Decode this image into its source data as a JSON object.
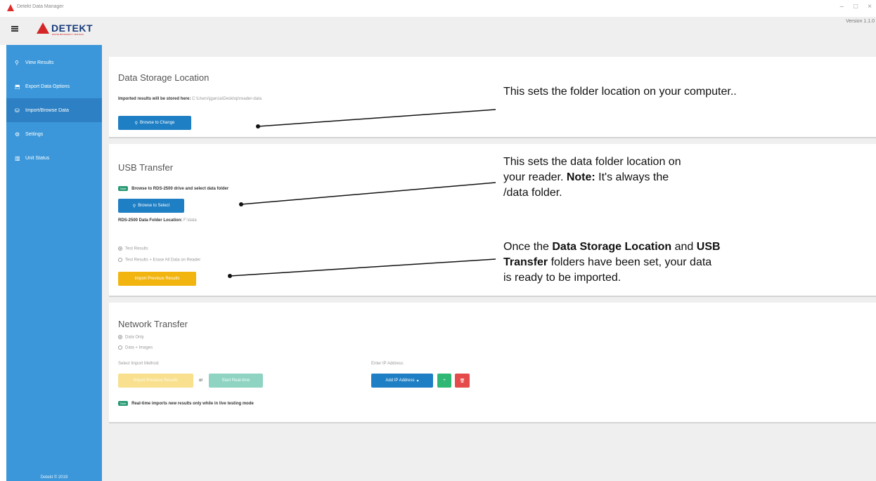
{
  "window": {
    "title": "Detekt Data Manager",
    "version": "Version 1.1.0",
    "controls": [
      "–",
      "□",
      "×"
    ]
  },
  "logo": {
    "name": "DETEKT",
    "tagline": "RAPID BIOSAFETY TESTING"
  },
  "sidebar": {
    "items": [
      {
        "label": "View Results",
        "icon": "search-icon"
      },
      {
        "label": "Export Data Options",
        "icon": "export-icon"
      },
      {
        "label": "Import/Browse Data",
        "icon": "database-icon",
        "active": true
      },
      {
        "label": "Settings",
        "icon": "gear-icon"
      },
      {
        "label": "Unit Status",
        "icon": "status-icon"
      }
    ],
    "footer": "Detekt © 2019"
  },
  "storage": {
    "title": "Data Storage Location",
    "label": "Imported results will be stored here:",
    "path": "C:\\Users\\jgarcia\\Desktop\\reader-data",
    "button": "Browse to Change"
  },
  "usb": {
    "title": "USB Transfer",
    "note_badge": "Note",
    "note_text": "Browse to RDS-2500 drive and select data folder",
    "button": "Browse to Select",
    "folder_label": "RDS-2500 Data Folder Location:",
    "folder_value": "F:\\data",
    "options": [
      "Test Results",
      "Test Results + Erase All Data on Reader"
    ],
    "import_button": "Import Previous Results"
  },
  "network": {
    "title": "Network Transfer",
    "options": [
      "Data Only",
      "Data + Images"
    ],
    "method_label": "Select Import Method:",
    "import_button": "Import Previous Results",
    "or_text": "or",
    "realtime_button": "Start Real-time",
    "ip_label": "Enter IP Address:",
    "ip_button": "Add IP Address",
    "plus_label": "+",
    "delete_label": "🗑",
    "note_badge": "Note",
    "note_text": "Real-time imports new results only while in live testing mode"
  },
  "annotations": {
    "a1": "This sets the folder location on your computer..",
    "a2_line1": "This sets the data folder location on",
    "a2_line2_pre": "your reader. ",
    "a2_line2_bold": "Note:",
    "a2_line2_post": " It's always the",
    "a2_line3": "/data folder.",
    "a3_l1_pre": "Once the ",
    "a3_l1_bold1": "Data Storage Location",
    "a3_l1_mid": " and ",
    "a3_l1_bold2": "USB",
    "a3_l2_bold": "Transfer",
    "a3_l2_post": " folders have been set, your data",
    "a3_l3": "is ready to be imported."
  },
  "colors": {
    "sidebar": "#3b97d9",
    "sidebar_active": "#2c80c3",
    "primary_button": "#1f7fc4",
    "warning_button": "#f2b40e",
    "success_button": "#2fb873",
    "danger_button": "#e54b4b"
  }
}
